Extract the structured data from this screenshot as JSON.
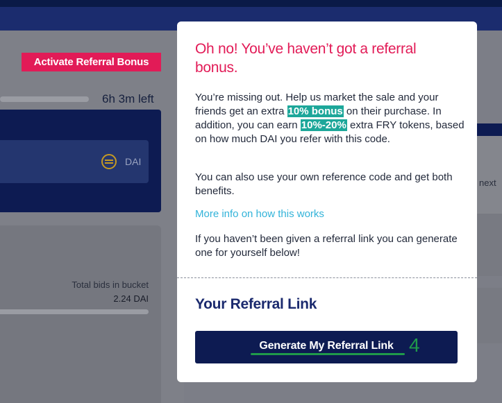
{
  "background": {
    "activate_button_label": "Activate Referral Bonus",
    "time_left": "6h 3m left",
    "currency_label": "DAI",
    "bucket_label": "Total bids in bucket",
    "bucket_value": "2.24 DAI",
    "right_next_text": "next"
  },
  "modal": {
    "title": "Oh no! You’ve haven’t got a referral bonus.",
    "p1_part1": "You’re missing out. Help us market the sale and your friends get an extra ",
    "p1_hl1": "10% bonus",
    "p1_part2": " on their purchase. In addition, you can earn ",
    "p1_hl2": "10%-20%",
    "p1_part3": " extra FRY tokens, based on how much DAI you refer with this code.",
    "p2": "You can also use your own reference code and get both benefits.",
    "more_info_link": "More info on how this works",
    "p3": "If you haven’t been given a referral link you can generate one for yourself below!",
    "referral_heading": "Your Referral Link",
    "generate_button": "Generate My Referral Link",
    "annotation_number": "4"
  },
  "colors": {
    "brand_pink": "#e21b57",
    "navy": "#0d1b52",
    "highlight_teal": "#1da79a",
    "link_blue": "#32b3d9",
    "annotation_green": "#1f9a4a"
  }
}
